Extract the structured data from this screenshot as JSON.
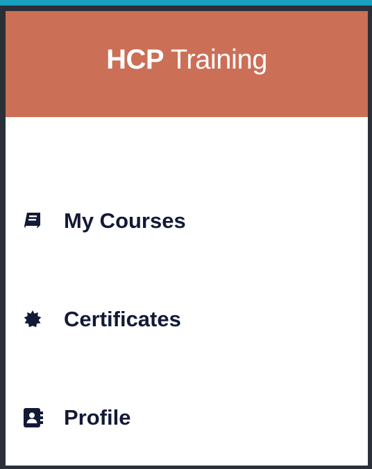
{
  "app": {
    "brand_strong": "HCP",
    "brand_rest": "Training"
  },
  "nav": {
    "items": [
      {
        "label": "My Courses",
        "icon": "book-icon"
      },
      {
        "label": "Certificates",
        "icon": "badge-icon"
      },
      {
        "label": "Profile",
        "icon": "contact-card-icon"
      }
    ]
  },
  "colors": {
    "header": "#cb6f57",
    "top_accent": "#1aa0bf",
    "frame": "#2a2f38",
    "nav_text": "#121a36"
  }
}
